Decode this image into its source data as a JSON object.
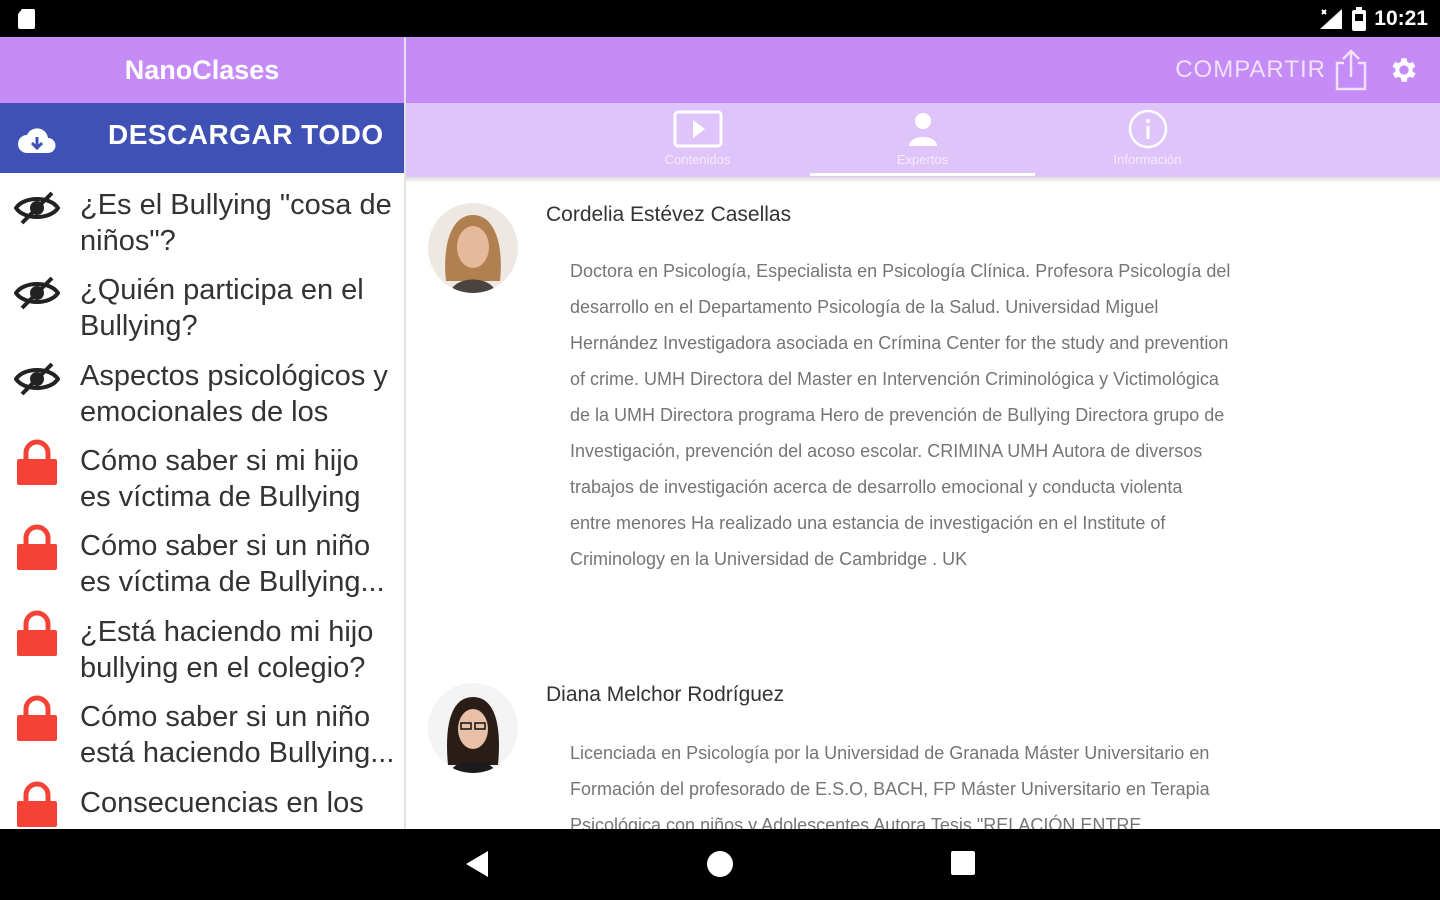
{
  "status_bar": {
    "time": "10:21",
    "icons": [
      "sd-card-icon",
      "signal-icon",
      "battery-icon"
    ]
  },
  "app": {
    "title": "NanoClases"
  },
  "toolbar": {
    "share_label": "COMPARTIR",
    "icons": [
      "share-icon",
      "gear-icon"
    ]
  },
  "download": {
    "label": "DESCARGAR TODO",
    "icon": "cloud-download-icon"
  },
  "tabs": [
    {
      "label": "Contenidos",
      "icon": "play-icon"
    },
    {
      "label": "Expertos",
      "icon": "person-icon",
      "selected": true
    },
    {
      "label": "Información",
      "icon": "info-icon"
    }
  ],
  "lessons": [
    {
      "line1": "¿Es el Bullying \"cosa de",
      "line2": "niños\"?",
      "state": "hidden"
    },
    {
      "line1": "¿Quién participa en el",
      "line2": "Bullying?",
      "state": "hidden"
    },
    {
      "line1": "Aspectos psicológicos y",
      "line2": "emocionales de los",
      "state": "hidden"
    },
    {
      "line1": "Cómo saber si mi hijo",
      "line2": "es víctima de Bullying",
      "state": "locked"
    },
    {
      "line1": "Cómo saber si un niño",
      "line2": "es víctima de Bullying...",
      "state": "locked"
    },
    {
      "line1": "¿Está haciendo mi hijo",
      "line2": "bullying en el colegio?",
      "state": "locked"
    },
    {
      "line1": "Cómo saber si un niño",
      "line2": "está haciendo Bullying...",
      "state": "locked"
    },
    {
      "line1": "Consecuencias en los",
      "line2": "",
      "state": "locked"
    }
  ],
  "experts": [
    {
      "name": "Cordelia Estévez Casellas",
      "bio_lines": [
        "Doctora en Psicología, Especialista en Psicología Clínica. Profesora Psicología del",
        "desarrollo en el Departamento Psicología de la Salud. Universidad Miguel",
        "Hernández Investigadora asociada en Crímina Center for the study and prevention",
        "of crime. UMH Directora del Master en Intervención Criminológica y Victimológica",
        "de la UMH Directora programa Hero de prevención de Bullying Directora grupo de",
        "Investigación, prevención del acoso escolar. CRIMINA UMH Autora de diversos",
        "trabajos de investigación acerca de desarrollo emocional y conducta violenta",
        "entre menores Ha realizado una estancia de investigación en el Institute of",
        "Criminology en la Universidad de Cambridge . UK"
      ]
    },
    {
      "name": "Diana Melchor Rodríguez",
      "bio_lines": [
        "Licenciada en Psicología por la Universidad de Granada Máster Universitario en",
        "Formación del profesorado de E.S.O, BACH, FP Máster Universitario en Terapia",
        "Psicológica con niños y Adolescentes Autora Tesis \"RELACIÓN ENTRE"
      ]
    }
  ],
  "colors": {
    "toolbar": "#c58bf7",
    "tabs": "#dfc4fa",
    "download_bar": "#3f51b5",
    "lock": "#f44336"
  }
}
